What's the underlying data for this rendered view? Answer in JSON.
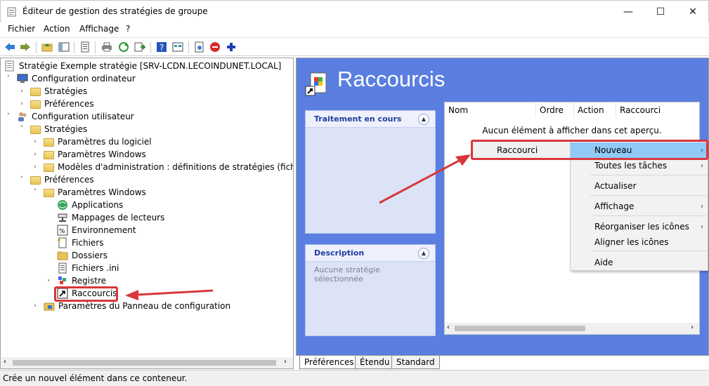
{
  "window": {
    "title": "Éditeur de gestion des stratégies de groupe",
    "minimize_glyph": "—",
    "maximize_glyph": "☐",
    "close_glyph": "✕"
  },
  "menu": [
    "Fichier",
    "Action",
    "Affichage",
    "?"
  ],
  "tree": {
    "root": "Stratégie Exemple stratégie [SRV-LCDN.LECOINDUNET.LOCAL]",
    "items": [
      {
        "label": "Configuration ordinateur"
      },
      {
        "label": "Stratégies"
      },
      {
        "label": "Préférences"
      },
      {
        "label": "Configuration utilisateur"
      },
      {
        "label": "Stratégies"
      },
      {
        "label": "Paramètres du logiciel"
      },
      {
        "label": "Paramètres Windows"
      },
      {
        "label": "Modèles d'administration : définitions de stratégies (fichiers AD"
      },
      {
        "label": "Préférences"
      },
      {
        "label": "Paramètres Windows"
      },
      {
        "label": "Applications"
      },
      {
        "label": "Mappages de lecteurs"
      },
      {
        "label": "Environnement"
      },
      {
        "label": "Fichiers"
      },
      {
        "label": "Dossiers"
      },
      {
        "label": "Fichiers .ini"
      },
      {
        "label": "Registre"
      },
      {
        "label": "Raccourcis"
      },
      {
        "label": "Paramètres du Panneau de configuration"
      }
    ]
  },
  "right_pane": {
    "title": "Raccourcis",
    "task_box": {
      "header": "Traitement en cours"
    },
    "description_box": {
      "header": "Description",
      "text": "Aucune stratégie sélectionnée"
    },
    "list": {
      "columns": [
        "Nom",
        "Ordre",
        "Action",
        "Raccourci"
      ],
      "empty_text": "Aucun élément à afficher dans cet aperçu."
    }
  },
  "context": {
    "parent_item": "Raccourci",
    "items": [
      {
        "label": "Nouveau",
        "submenu": true,
        "highlighted": true
      },
      {
        "label": "Toutes les tâches",
        "submenu": true
      },
      {
        "label": "Actualiser",
        "submenu": false
      },
      {
        "label": "Affichage",
        "submenu": true
      },
      {
        "label": "Réorganiser les icônes",
        "submenu": true
      },
      {
        "label": "Aligner les icônes",
        "submenu": false
      },
      {
        "label": "Aide",
        "submenu": false
      }
    ]
  },
  "tabs": [
    "Préférences",
    "Étendu",
    "Standard"
  ],
  "status": "Crée un nouvel élément dans ce conteneur.",
  "colors": {
    "accent": "#5a7fe0",
    "highlight": "#d8383a",
    "menu_hover": "#91c9f7"
  }
}
